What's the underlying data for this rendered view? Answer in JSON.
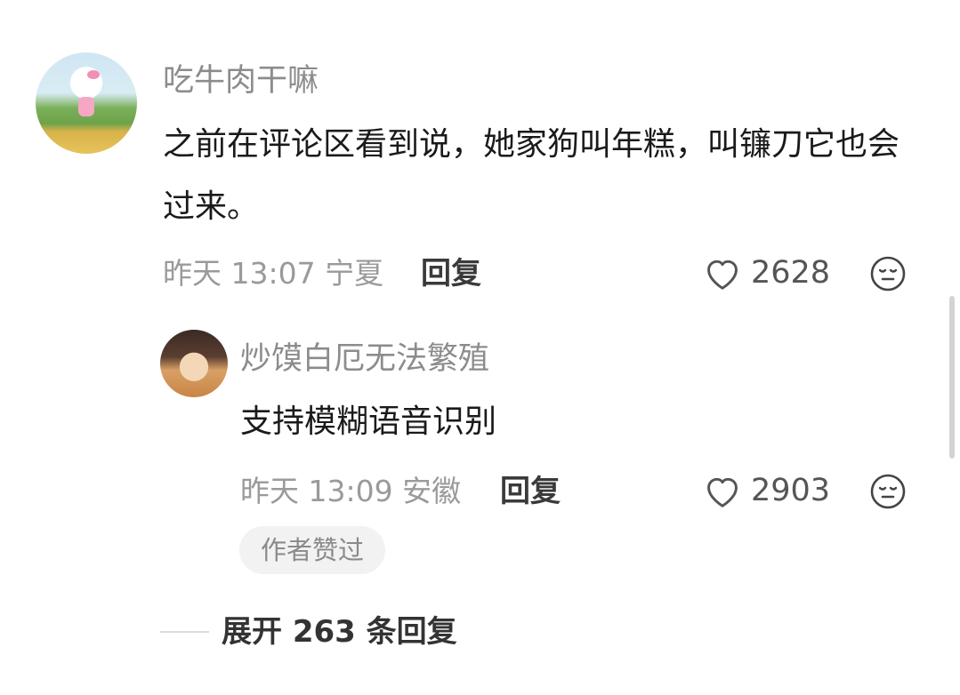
{
  "comment": {
    "username": "吃牛肉干嘛",
    "text": "之前在评论区看到说，她家狗叫年糕，叫镰刀它也会过来。",
    "time_location": "昨天 13:07 宁夏",
    "reply_label": "回复",
    "like_count": "2628",
    "avatar_icon": "hello-kitty-avatar",
    "like_icon": "heart-outline-icon",
    "emoji_icon": "neutral-face-icon"
  },
  "reply": {
    "username": "炒馍白厄无法繁殖",
    "text": "支持模糊语音识别",
    "time_location": "昨天 13:09 安徽",
    "reply_label": "回复",
    "like_count": "2903",
    "badge": "作者赞过",
    "avatar_icon": "cat-costume-avatar",
    "like_icon": "heart-outline-icon",
    "emoji_icon": "neutral-face-icon"
  },
  "expand_replies": "展开 263 条回复"
}
